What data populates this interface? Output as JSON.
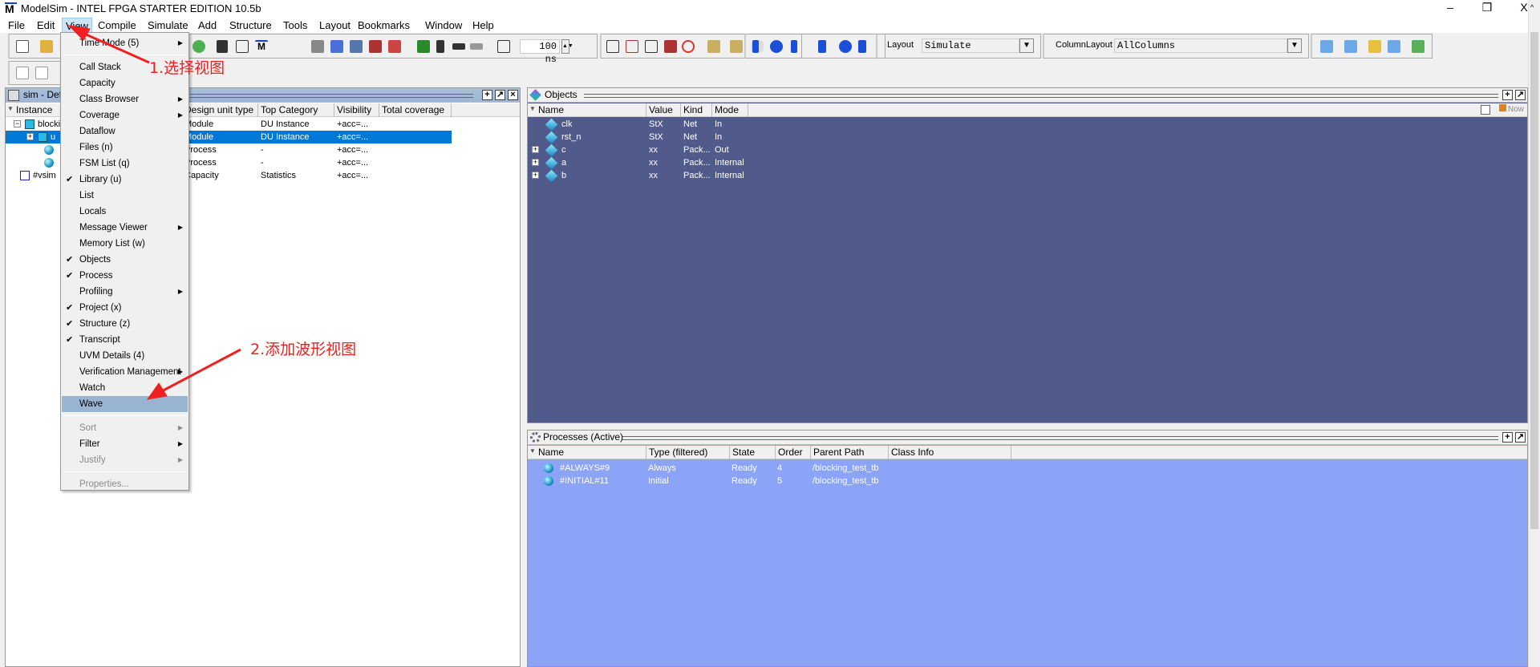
{
  "window": {
    "title": "ModelSim - INTEL FPGA STARTER EDITION 10.5b",
    "logo": "M",
    "minimize": "–",
    "restore": "❐",
    "close": "X"
  },
  "menubar": [
    "File",
    "Edit",
    "View",
    "Compile",
    "Simulate",
    "Add",
    "Structure",
    "Tools",
    "Layout",
    "Bookmarks",
    "Window",
    "Help"
  ],
  "toolbar": {
    "time_value": "100 ns",
    "layout_label": "Layout",
    "layout_value": "Simulate",
    "column_layout_label": "ColumnLayout",
    "column_layout_value": "AllColumns"
  },
  "view_menu": [
    {
      "label": "Time Mode (5)",
      "submenu": true
    },
    {
      "sep": true
    },
    {
      "label": "Call Stack"
    },
    {
      "label": "Capacity"
    },
    {
      "label": "Class Browser",
      "submenu": true
    },
    {
      "label": "Coverage",
      "submenu": true
    },
    {
      "label": "Dataflow"
    },
    {
      "label": "Files (n)"
    },
    {
      "label": "FSM List (q)"
    },
    {
      "label": "Library (u)",
      "checked": true
    },
    {
      "label": "List"
    },
    {
      "label": "Locals"
    },
    {
      "label": "Message Viewer",
      "submenu": true
    },
    {
      "label": "Memory List (w)"
    },
    {
      "label": "Objects",
      "checked": true
    },
    {
      "label": "Process",
      "checked": true
    },
    {
      "label": "Profiling",
      "submenu": true
    },
    {
      "label": "Project (x)",
      "checked": true
    },
    {
      "label": "Structure  (z)",
      "checked": true
    },
    {
      "label": "Transcript",
      "checked": true
    },
    {
      "label": "UVM Details (4)"
    },
    {
      "label": "Verification Management",
      "submenu": true
    },
    {
      "label": "Watch"
    },
    {
      "label": "Wave",
      "highlighted": true
    },
    {
      "sep": true
    },
    {
      "label": "Sort",
      "submenu": true,
      "disabled": true
    },
    {
      "label": "Filter",
      "submenu": true
    },
    {
      "label": "Justify",
      "submenu": true,
      "disabled": true
    },
    {
      "sep": true
    },
    {
      "label": "Properties...",
      "disabled": true
    }
  ],
  "sim_panel": {
    "title": "sim - Defa",
    "columns": [
      "Instance",
      "Design unit type",
      "Top Category",
      "Visibility",
      "Total coverage"
    ],
    "rows": [
      {
        "instance": "blocki",
        "type": "Module",
        "category": "DU Instance",
        "visibility": "+acc=..."
      },
      {
        "instance": "u",
        "type": "Module",
        "category": "DU Instance",
        "visibility": "+acc=...",
        "selected": true
      },
      {
        "instance": "#",
        "type": "Process",
        "category": "-",
        "visibility": "+acc=..."
      },
      {
        "instance": "#",
        "type": "Process",
        "category": "-",
        "visibility": "+acc=..."
      },
      {
        "instance": "#vsim",
        "type": "Capacity",
        "category": "Statistics",
        "visibility": "+acc=..."
      }
    ]
  },
  "objects_panel": {
    "title": "Objects",
    "columns": [
      "Name",
      "Value",
      "Kind",
      "Mode"
    ],
    "now_label": "Now",
    "rows": [
      {
        "name": "clk",
        "value": "StX",
        "kind": "Net",
        "mode": "In",
        "expandable": false
      },
      {
        "name": "rst_n",
        "value": "StX",
        "kind": "Net",
        "mode": "In",
        "expandable": false
      },
      {
        "name": "c",
        "value": "xx",
        "kind": "Pack...",
        "mode": "Out",
        "expandable": true
      },
      {
        "name": "a",
        "value": "xx",
        "kind": "Pack...",
        "mode": "Internal",
        "expandable": true
      },
      {
        "name": "b",
        "value": "xx",
        "kind": "Pack...",
        "mode": "Internal",
        "expandable": true
      }
    ]
  },
  "processes_panel": {
    "title": "Processes (Active)",
    "columns": [
      "Name",
      "Type (filtered)",
      "State",
      "Order",
      "Parent Path",
      "Class Info"
    ],
    "rows": [
      {
        "name": "#ALWAYS#9",
        "type": "Always",
        "state": "Ready",
        "order": "4",
        "parent": "/blocking_test_tb"
      },
      {
        "name": "#INITIAL#11",
        "type": "Initial",
        "state": "Ready",
        "order": "5",
        "parent": "/blocking_test_tb"
      }
    ]
  },
  "annotations": {
    "step1": "1.选择视图",
    "step2": "2.添加波形视图"
  },
  "colors": {
    "objects_bg": "#515b8b",
    "processes_bg": "#8ca4f8",
    "selection": "#0078d7",
    "annotation": "#f02020",
    "menu_highlight": "#99b4d1"
  }
}
